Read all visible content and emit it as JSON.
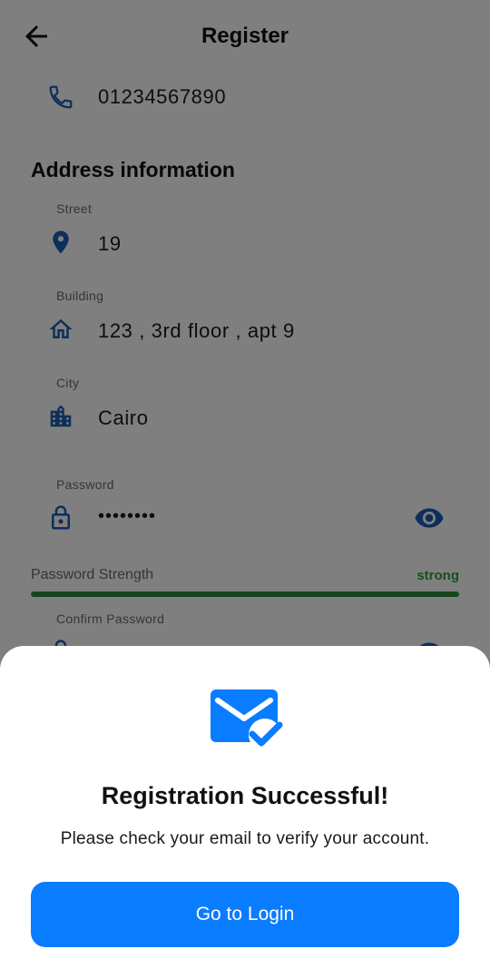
{
  "appbar": {
    "title": "Register",
    "back_icon": "arrow-left-icon"
  },
  "form": {
    "phone": {
      "value": "01234567890",
      "icon": "phone-icon"
    },
    "address_section_title": "Address information",
    "street": {
      "label": "Street",
      "value": "19",
      "icon": "location-pin-icon"
    },
    "building": {
      "label": "Building",
      "value": "123 , 3rd floor , apt 9",
      "icon": "home-icon"
    },
    "city": {
      "label": "City",
      "value": "Cairo",
      "icon": "city-icon"
    },
    "password": {
      "label": "Password",
      "value": "••••••••",
      "icon": "lock-icon",
      "toggle_icon": "eye-icon"
    },
    "password_strength": {
      "label": "Password Strength",
      "value": "strong",
      "fill_fraction": 1.0,
      "color": "#2e8b3a"
    },
    "confirm_password": {
      "label": "Confirm Password"
    }
  },
  "dialog": {
    "icon": "mail-check-icon",
    "title": "Registration Successful!",
    "message": "Please check your email to verify your account.",
    "button_label": "Go to Login"
  },
  "colors": {
    "accent": "#0a7cff",
    "icon_blue": "#1a5fb4",
    "strength_green": "#2e8b3a",
    "overlay": "rgba(0,0,0,0.5)"
  }
}
